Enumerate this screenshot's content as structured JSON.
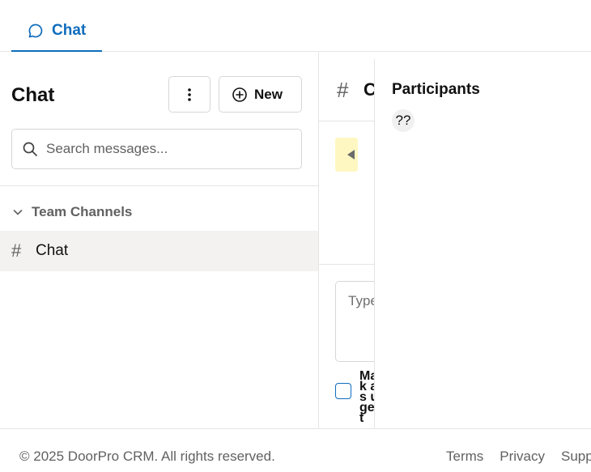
{
  "top_tabs": [
    {
      "label": "Chat",
      "icon": "chat-bubble-icon",
      "active": true
    }
  ],
  "sidebar": {
    "title": "Chat",
    "more_icon": "more-vertical-icon",
    "new_button_label": "New",
    "new_icon": "add-circle-icon",
    "search_placeholder": "Search messages...",
    "group_label": "Team Channels",
    "channels": [
      {
        "label": "Chat",
        "selected": true
      }
    ]
  },
  "chat": {
    "header_title": "Chat",
    "compose_placeholder": "Type a message...",
    "checkbox_label": "Mark as urgent"
  },
  "participants": {
    "title": "Participants",
    "avatars": [
      "??"
    ]
  },
  "footer": {
    "copyright": "© 2025 DoorPro CRM. All rights reserved.",
    "links": [
      "Terms",
      "Privacy",
      "Support"
    ]
  },
  "colors": {
    "accent": "#0f6cbd",
    "selected_bg": "#f3f2f1",
    "highlight": "#fff7c2",
    "border": "#e5e5e5",
    "muted_text": "#616161"
  }
}
